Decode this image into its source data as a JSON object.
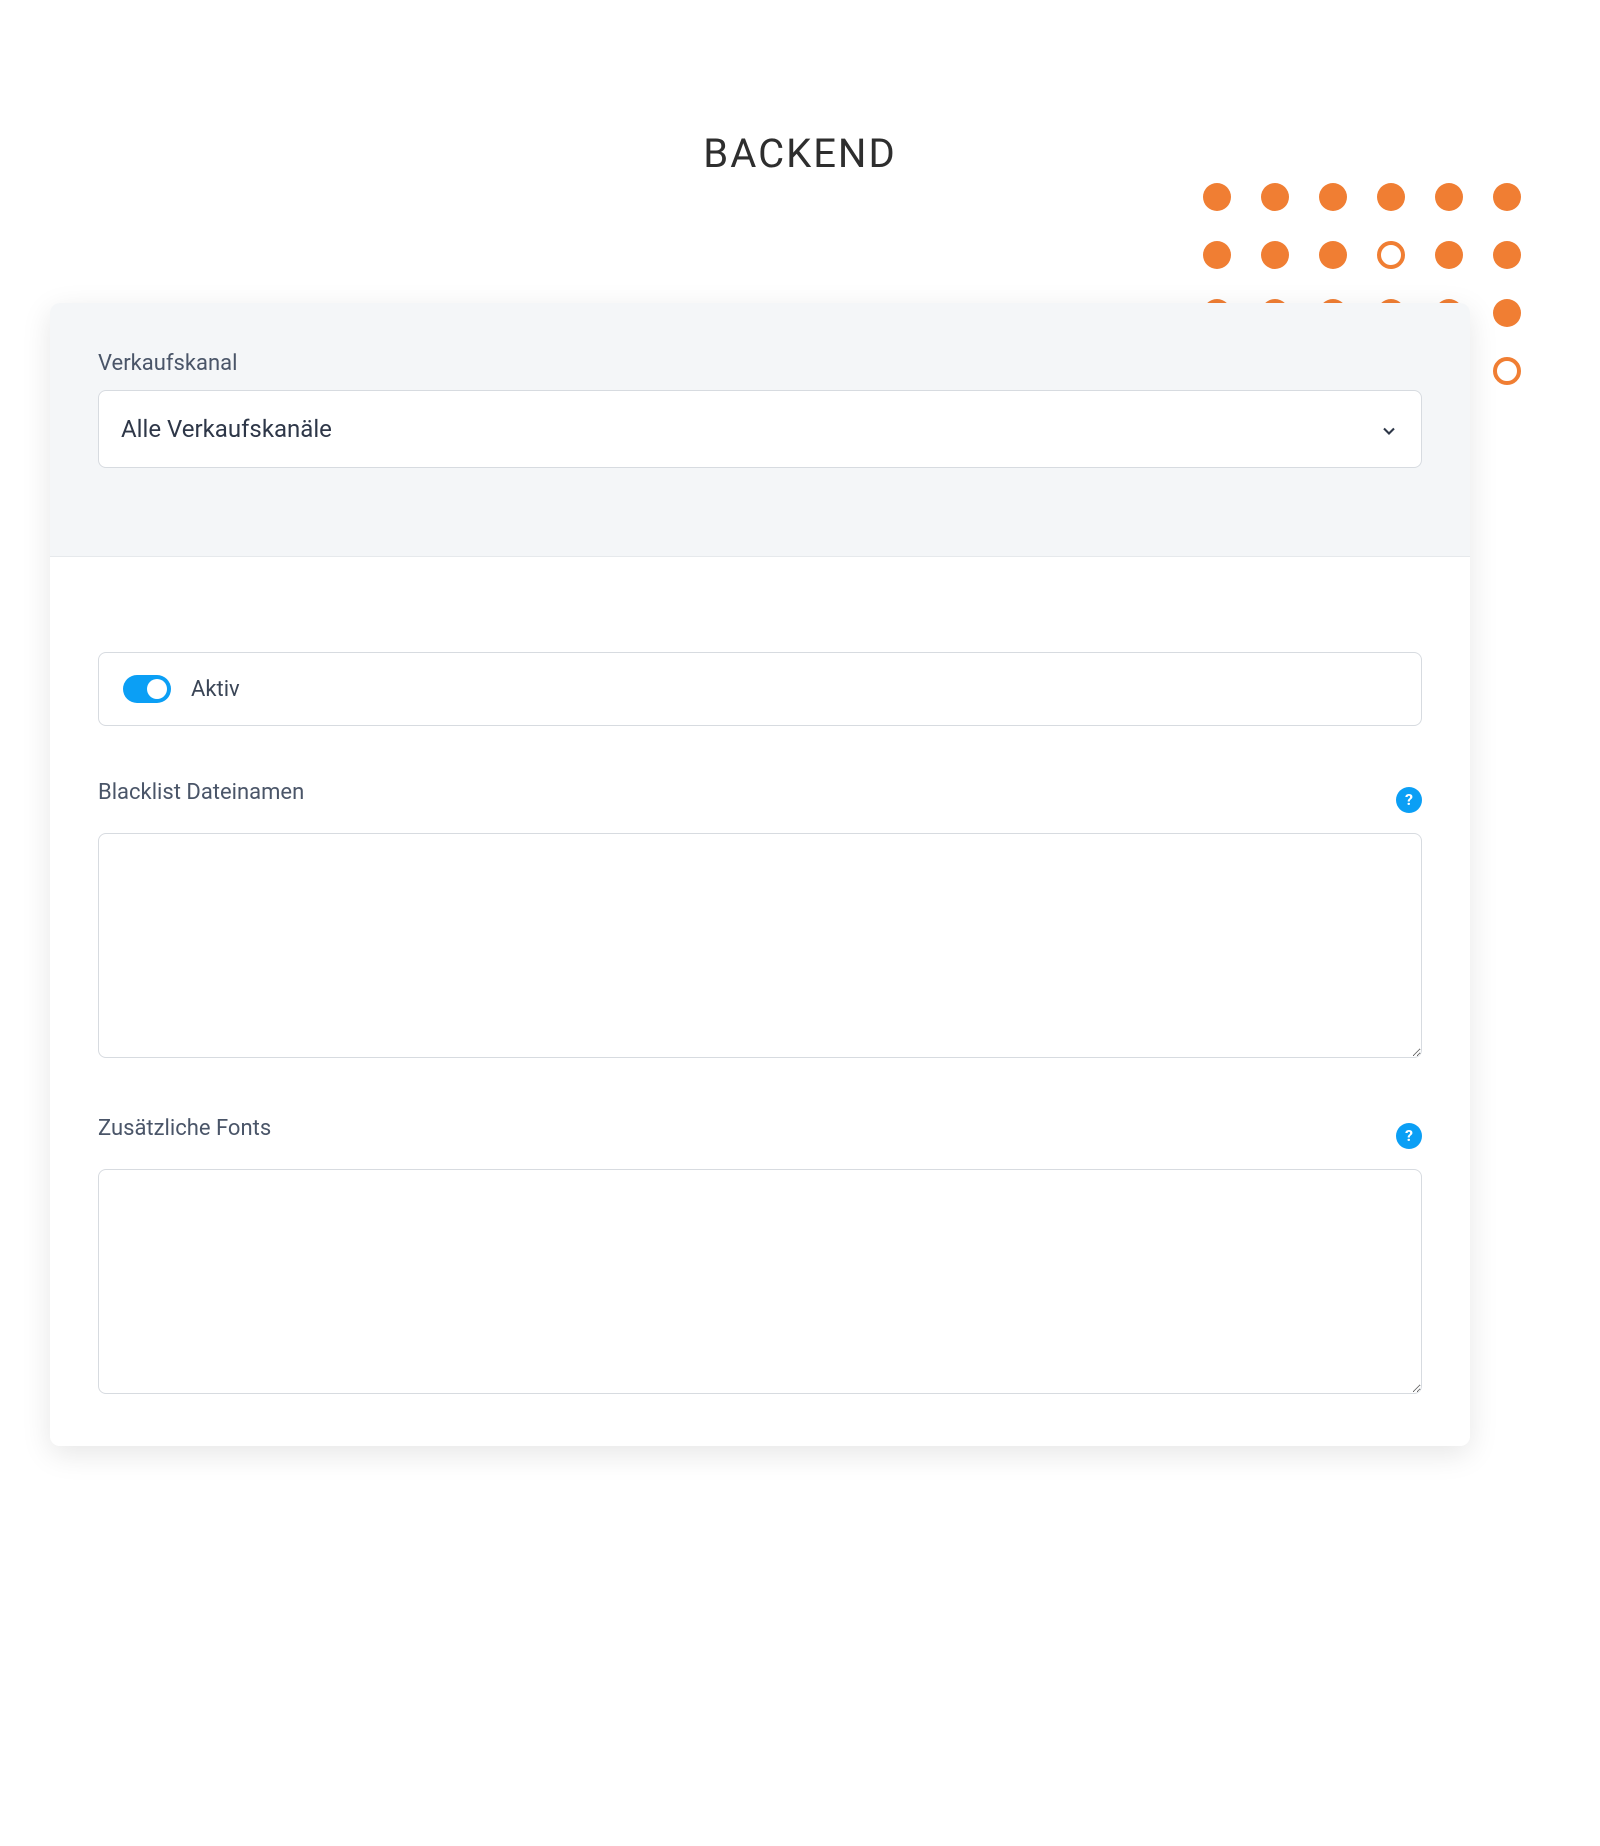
{
  "page_title": "BACKEND",
  "header": {
    "channel_label": "Verkaufskanal",
    "channel_selected": "Alle Verkaufskanäle"
  },
  "body": {
    "active_toggle_label": "Aktiv",
    "active_toggle_on": true,
    "blacklist": {
      "label": "Blacklist Dateinamen",
      "value": ""
    },
    "fonts": {
      "label": "Zusätzliche Fonts",
      "value": ""
    },
    "help_glyph": "?"
  },
  "decor": {
    "hollow_dots": [
      9,
      23
    ]
  }
}
